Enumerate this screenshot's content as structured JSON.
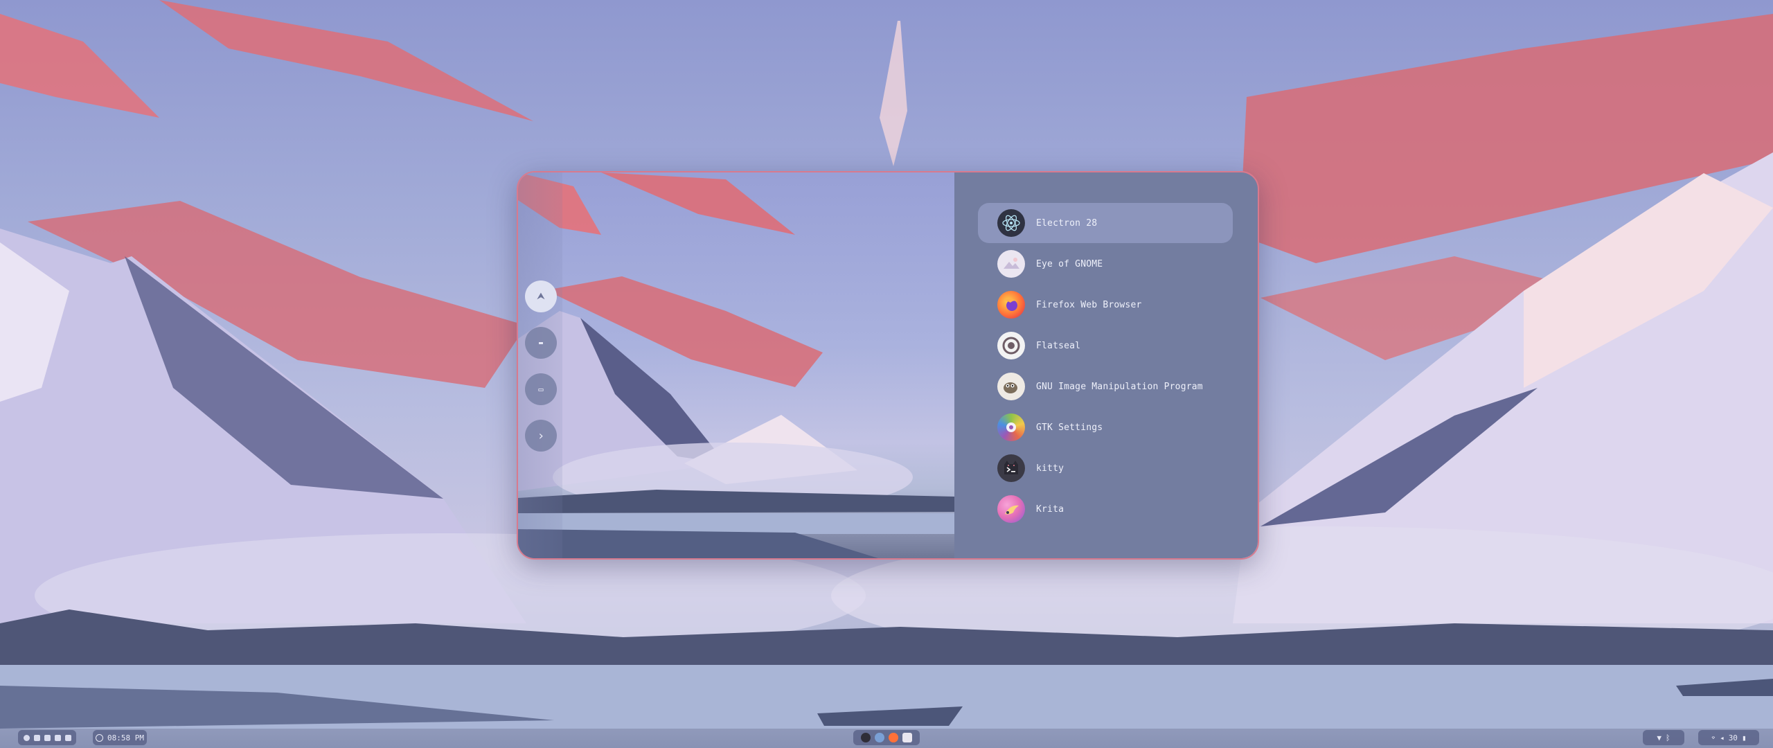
{
  "launcher": {
    "rail": [
      {
        "name": "apps",
        "icon": "grid-icon",
        "glyph": "⮝"
      },
      {
        "name": "files",
        "icon": "folder-icon",
        "glyph": "▬"
      },
      {
        "name": "windows",
        "icon": "window-icon",
        "glyph": "▭"
      },
      {
        "name": "run",
        "icon": "terminal-icon",
        "glyph": "›"
      }
    ],
    "apps": [
      {
        "label": "Electron 28",
        "icon": "electron-icon",
        "color": "#2f3242",
        "selected": true
      },
      {
        "label": "Eye of GNOME",
        "icon": "eye-of-gnome-icon",
        "color": "#e9e4ef"
      },
      {
        "label": "Firefox Web Browser",
        "icon": "firefox-icon",
        "color": "#ff7139"
      },
      {
        "label": "Flatseal",
        "icon": "flatseal-icon",
        "color": "#f2f2f2"
      },
      {
        "label": "GNU Image Manipulation Program",
        "icon": "gimp-icon",
        "color": "#efeae4"
      },
      {
        "label": "GTK Settings",
        "icon": "gtk-settings-icon",
        "color": "#8fc34a"
      },
      {
        "label": "kitty",
        "icon": "kitty-icon",
        "color": "#3b3a46"
      },
      {
        "label": "Krita",
        "icon": "krita-icon",
        "color": "#e46fb6"
      }
    ]
  },
  "taskbar": {
    "clock": "08:58 PM",
    "workspace_icons": [
      "workspace-1-icon",
      "workspace-2-icon",
      "workspace-3-icon",
      "workspace-4-icon",
      "workspace-5-icon"
    ],
    "dock": [
      "kitty-dock-icon",
      "electron-dock-icon",
      "firefox-dock-icon",
      "files-dock-icon"
    ],
    "status": {
      "volume": "30"
    }
  }
}
